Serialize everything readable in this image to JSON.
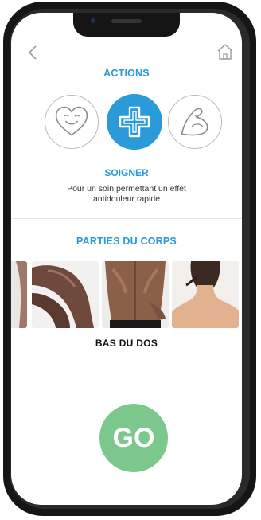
{
  "header": {
    "back_icon": "chevron-left-icon",
    "home_icon": "home-icon"
  },
  "actions": {
    "title": "ACTIONS",
    "items": [
      {
        "id": "love",
        "icon": "smiling-heart-icon",
        "selected": false
      },
      {
        "id": "heal",
        "icon": "medical-cross-icon",
        "selected": true
      },
      {
        "id": "strength",
        "icon": "flexed-arm-icon",
        "selected": false
      }
    ],
    "selected_label": "SOIGNER",
    "selected_description": "Pour un soin permettant un effet antidouleur rapide"
  },
  "body_parts": {
    "title": "PARTIES DU CORPS",
    "selected_label": "BAS DU DOS"
  },
  "go_button": {
    "label": "GO",
    "color": "#7cc88c"
  },
  "colors": {
    "accent": "#2a9ad8",
    "go_green": "#7cc88c"
  }
}
